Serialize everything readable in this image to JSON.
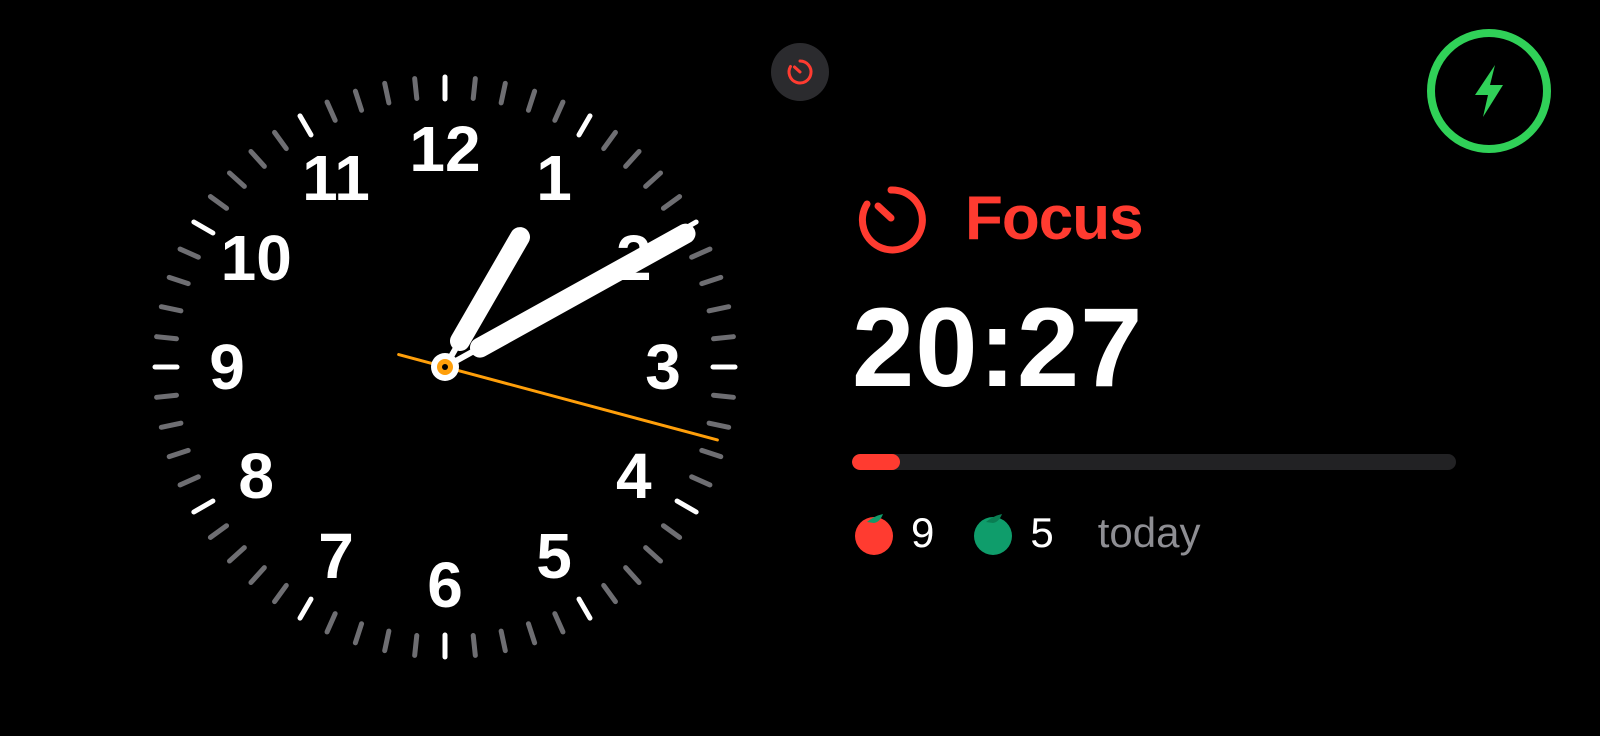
{
  "clock": {
    "numerals": [
      "12",
      "1",
      "2",
      "3",
      "4",
      "5",
      "6",
      "7",
      "8",
      "9",
      "10",
      "11"
    ],
    "hour_hand_angle_deg": 30,
    "minute_hand_angle_deg": 61,
    "second_hand_angle_deg": 105
  },
  "focus": {
    "label": "Focus",
    "time": "20:27",
    "progress_fraction": 0.08,
    "completed_count": "9",
    "remaining_count": "5",
    "period": "today"
  },
  "colors": {
    "accent_red": "#ff3b30",
    "accent_green": "#30d158",
    "tomato_green": "#0f9d6b",
    "second_hand": "#ff9f0a",
    "muted_text": "#8e8e93"
  },
  "icons": {
    "focus": "timer-icon",
    "charging": "bolt-icon",
    "completed": "red-tomato-icon",
    "remaining": "green-tomato-icon"
  }
}
